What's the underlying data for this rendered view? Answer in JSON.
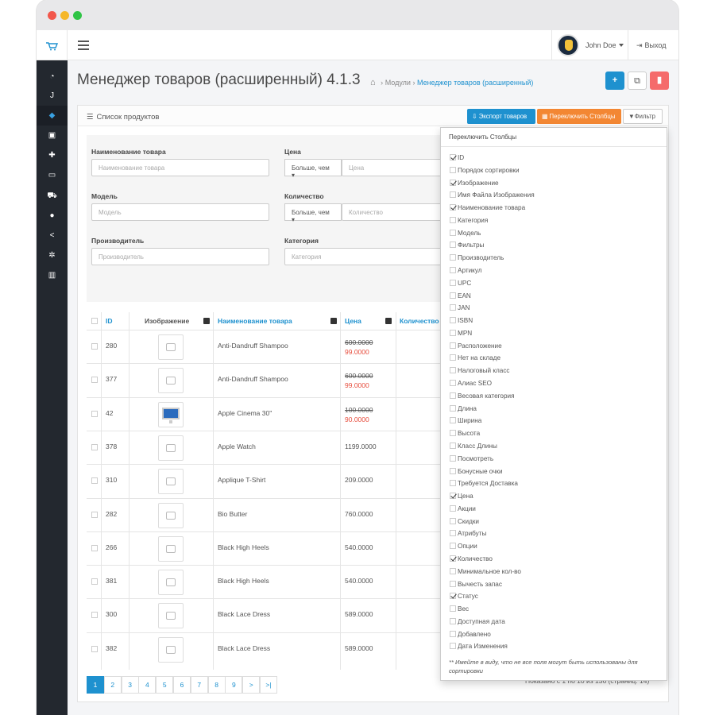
{
  "header": {
    "user_name": "John Doe",
    "logout_label": "Выход"
  },
  "page": {
    "title": "Менеджер товаров (расширенный) 4.1.3",
    "breadcrumbs": [
      "Модули",
      "Менеджер товаров (расширенный)"
    ]
  },
  "panel": {
    "title": "Список продуктов",
    "export_label": "Экспорт товаров",
    "toggle_label": "Переключить Столбцы",
    "filter_label": "Фильтр"
  },
  "filters": {
    "name_label": "Наименование товара",
    "name_placeholder": "Наименование товара",
    "price_label": "Цена",
    "price_op": "Больше, чем",
    "price_placeholder": "Цена",
    "model_label": "Модель",
    "model_placeholder": "Модель",
    "qty_label": "Количество",
    "qty_op": "Больше, чем",
    "qty_placeholder": "Количество",
    "manufacturer_label": "Производитель",
    "manufacturer_placeholder": "Производитель",
    "category_label": "Категория",
    "category_placeholder": "Категория"
  },
  "table": {
    "headers": {
      "id": "ID",
      "image": "Изображение",
      "name": "Наименование товара",
      "price": "Цена",
      "quantity": "Количество"
    },
    "rows": [
      {
        "id": "280",
        "name": "Anti-Dandruff Shampoo",
        "price_old": "600.0000",
        "price": "99.0000",
        "image": "placeholder"
      },
      {
        "id": "377",
        "name": "Anti-Dandruff Shampoo",
        "price_old": "600.0000",
        "price": "99.0000",
        "image": "placeholder"
      },
      {
        "id": "42",
        "name": "Apple Cinema 30\"",
        "price_old": "100.0000",
        "price": "90.0000",
        "image": "monitor"
      },
      {
        "id": "378",
        "name": "Apple Watch",
        "price_old": "",
        "price": "1199.0000",
        "image": "placeholder"
      },
      {
        "id": "310",
        "name": "Applique T-Shirt",
        "price_old": "",
        "price": "209.0000",
        "image": "placeholder"
      },
      {
        "id": "282",
        "name": "Bio Butter",
        "price_old": "",
        "price": "760.0000",
        "image": "placeholder"
      },
      {
        "id": "266",
        "name": "Black High Heels",
        "price_old": "",
        "price": "540.0000",
        "image": "placeholder"
      },
      {
        "id": "381",
        "name": "Black High Heels",
        "price_old": "",
        "price": "540.0000",
        "image": "placeholder"
      },
      {
        "id": "300",
        "name": "Black Lace Dress",
        "price_old": "",
        "price": "589.0000",
        "image": "placeholder"
      },
      {
        "id": "382",
        "name": "Black Lace Dress",
        "price_old": "",
        "price": "589.0000",
        "image": "placeholder"
      }
    ]
  },
  "pagination": {
    "pages": [
      "1",
      "2",
      "3",
      "4",
      "5",
      "6",
      "7",
      "8",
      "9",
      ">",
      ">|"
    ],
    "active": "1",
    "showing": "Показано с 1 по 10 из 136 (страниц: 14)"
  },
  "columns_dropdown": {
    "title": "Переключить Столбцы",
    "items": [
      {
        "label": "ID",
        "checked": true
      },
      {
        "label": "Порядок сортировки",
        "checked": false
      },
      {
        "label": "Изображение",
        "checked": true
      },
      {
        "label": "Имя Файла Изображения",
        "checked": false
      },
      {
        "label": "Наименование товара",
        "checked": true
      },
      {
        "label": "Категория",
        "checked": false
      },
      {
        "label": "Модель",
        "checked": false
      },
      {
        "label": "Фильтры",
        "checked": false
      },
      {
        "label": "Производитель",
        "checked": false
      },
      {
        "label": "Артикул",
        "checked": false
      },
      {
        "label": "UPC",
        "checked": false
      },
      {
        "label": "EAN",
        "checked": false
      },
      {
        "label": "JAN",
        "checked": false
      },
      {
        "label": "ISBN",
        "checked": false
      },
      {
        "label": "MPN",
        "checked": false
      },
      {
        "label": "Расположение",
        "checked": false
      },
      {
        "label": "Нет на складе",
        "checked": false
      },
      {
        "label": "Налоговый класс",
        "checked": false
      },
      {
        "label": "Алиас SEO",
        "checked": false
      },
      {
        "label": "Весовая категория",
        "checked": false
      },
      {
        "label": "Длина",
        "checked": false
      },
      {
        "label": "Ширина",
        "checked": false
      },
      {
        "label": "Высота",
        "checked": false
      },
      {
        "label": "Класс Длины",
        "checked": false
      },
      {
        "label": "Посмотреть",
        "checked": false
      },
      {
        "label": "Бонусные очки",
        "checked": false
      },
      {
        "label": "Требуется Доставка",
        "checked": false
      },
      {
        "label": "Цена",
        "checked": true
      },
      {
        "label": "Акции",
        "checked": false
      },
      {
        "label": "Скидки",
        "checked": false
      },
      {
        "label": "Атрибуты",
        "checked": false
      },
      {
        "label": "Опции",
        "checked": false
      },
      {
        "label": "Количество",
        "checked": true
      },
      {
        "label": "Минимальное кол-во",
        "checked": false
      },
      {
        "label": "Вычесть запас",
        "checked": false
      },
      {
        "label": "Статус",
        "checked": true
      },
      {
        "label": "Вес",
        "checked": false
      },
      {
        "label": "Доступная дата",
        "checked": false
      },
      {
        "label": "Добавлено",
        "checked": false
      },
      {
        "label": "Дата Изменения",
        "checked": false
      }
    ],
    "note": "** Имейте в виду, что не все поля могут быть использованы для сортировки"
  },
  "sidebar": {
    "items": [
      "dashboard-icon",
      "joomla-icon",
      "tag-icon",
      "image-icon",
      "puzzle-icon",
      "desktop-icon",
      "cart-icon",
      "user-icon",
      "share-icon",
      "cog-icon",
      "chart-icon"
    ],
    "active_index": 2
  }
}
